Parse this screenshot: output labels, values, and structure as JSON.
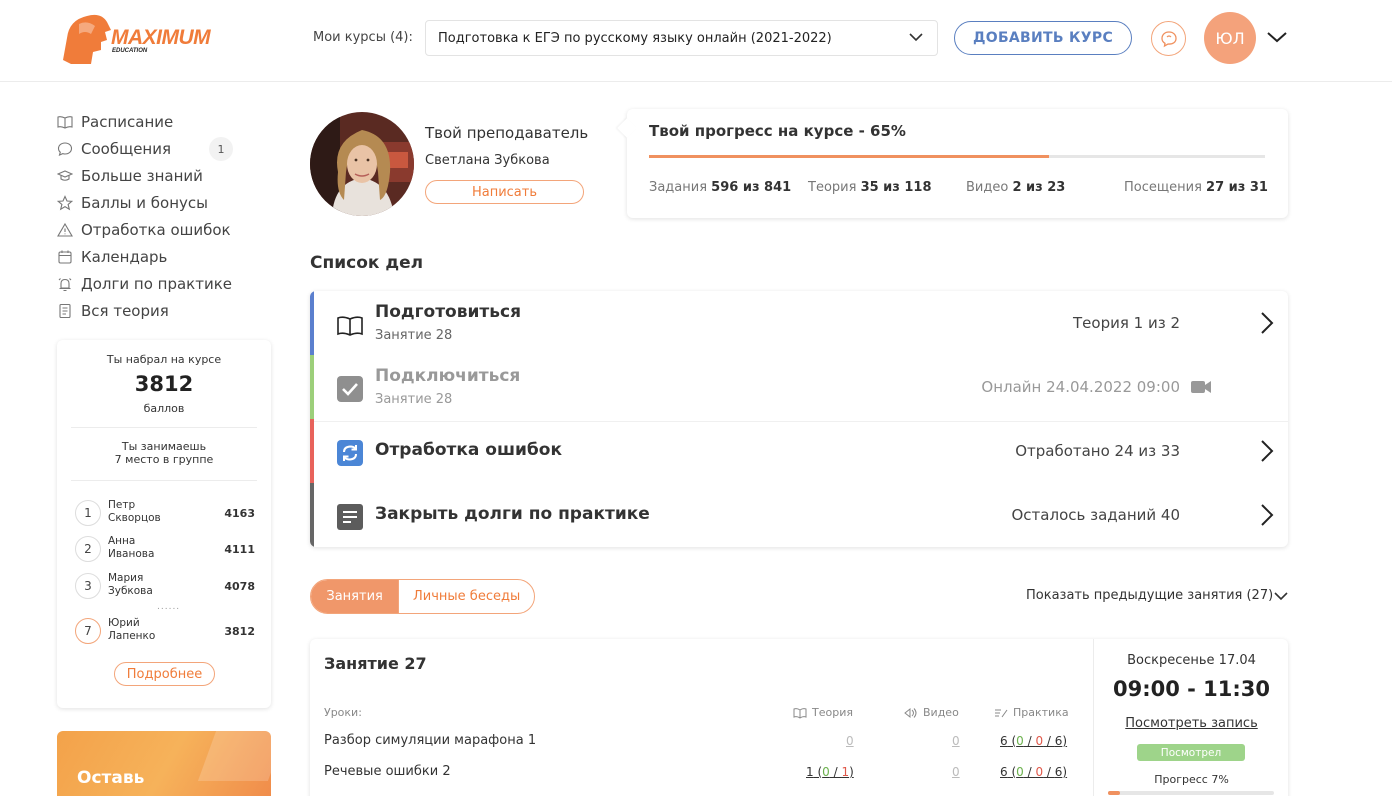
{
  "header": {
    "logo_text": "MAXIMUM",
    "logo_sub": "EDUCATION",
    "courses_label": "Мои курсы (4):",
    "selected_course": "Подготовка к ЕГЭ по русскому языку онлайн (2021-2022)",
    "add_course_label": "ДОБАВИТЬ КУРС",
    "user_initials": "ЮЛ"
  },
  "sidebar": {
    "items": [
      {
        "label": "Расписание",
        "icon": "book-icon"
      },
      {
        "label": "Сообщения",
        "icon": "chat-icon",
        "badge": "1"
      },
      {
        "label": "Больше знаний",
        "icon": "graduation-cap-icon"
      },
      {
        "label": "Баллы и бонусы",
        "icon": "star-icon"
      },
      {
        "label": "Отработка ошибок",
        "icon": "warning-icon"
      },
      {
        "label": "Календарь",
        "icon": "calendar-icon"
      },
      {
        "label": "Долги по практике",
        "icon": "alarm-icon"
      },
      {
        "label": "Вся теория",
        "icon": "document-icon"
      }
    ]
  },
  "score": {
    "label": "Ты набрал на курсе",
    "value": "3812",
    "unit": "баллов",
    "rank_line1": "Ты занимаешь",
    "rank_line2": "7 место в группе",
    "leaders": [
      {
        "place": "1",
        "first": "Петр",
        "last": "Скворцов",
        "points": "4163"
      },
      {
        "place": "2",
        "first": "Анна",
        "last": "Иванова",
        "points": "4111"
      },
      {
        "place": "3",
        "first": "Мария",
        "last": "Зубкова",
        "points": "4078"
      },
      {
        "place": "7",
        "first": "Юрий",
        "last": "Лапенко",
        "points": "3812"
      }
    ],
    "dots": "......",
    "more_label": "Подробнее"
  },
  "promo": {
    "text": "Оставь"
  },
  "teacher": {
    "title": "Твой преподаватель",
    "name": "Светлана Зубкова",
    "write_label": "Написать"
  },
  "progress": {
    "title": "Твой прогресс на курсе - 65%",
    "percent": 65,
    "stats": [
      {
        "label": "Задания",
        "value": "596 из 841"
      },
      {
        "label": "Теория",
        "value": "35 из 118"
      },
      {
        "label": "Видео",
        "value": "2 из 23"
      },
      {
        "label": "Посещения",
        "value": "27 из 31"
      }
    ]
  },
  "todo": {
    "title": "Список дел",
    "items": [
      {
        "name": "Подготовиться",
        "sub": "Занятие 28",
        "status": "Теория 1 из 2",
        "color": "#5b7fce",
        "icon": "open-book-icon"
      },
      {
        "name": "Подключиться",
        "sub": "Занятие 28",
        "status": "Онлайн 24.04.2022 09:00",
        "color": "#9ccf7a",
        "icon": "checkbox-icon"
      },
      {
        "name": "Отработка ошибок",
        "sub": "",
        "status": "Отработано 24 из 33",
        "color": "#e8625b",
        "icon": "refresh-icon"
      },
      {
        "name": "Закрыть долги по практике",
        "sub": "",
        "status": "Осталось заданий 40",
        "color": "#666666",
        "icon": "notes-icon"
      }
    ]
  },
  "lessons": {
    "tabs": [
      "Занятия",
      "Личные беседы"
    ],
    "show_prev": "Показать предыдущие занятия (27)",
    "card": {
      "title": "Занятие 27",
      "lessons_label": "Уроки:",
      "col_theory": "Теория",
      "col_video": "Видео",
      "col_practice": "Практика",
      "rows": [
        {
          "name": "Разбор симуляции марафона 1",
          "theory": "0",
          "video": "0",
          "practice_total": "6",
          "p_green": "0",
          "p_red": "0",
          "p_all": "6"
        },
        {
          "name": "Речевые ошибки 2",
          "theory_total": "1",
          "t_green": "0",
          "t_all": "1",
          "video": "0",
          "practice_total": "6",
          "p_green": "0",
          "p_red": "0",
          "p_all": "6"
        }
      ],
      "date": "Воскресенье 17.04",
      "time": "09:00 - 11:30",
      "watch_link": "Посмотреть запись",
      "watched_badge": "Посмотрел",
      "progress_label": "Прогресс 7%",
      "progress_percent": 7
    }
  },
  "colors": {
    "accent": "#f07c3a",
    "blue": "#5a7fc0"
  }
}
